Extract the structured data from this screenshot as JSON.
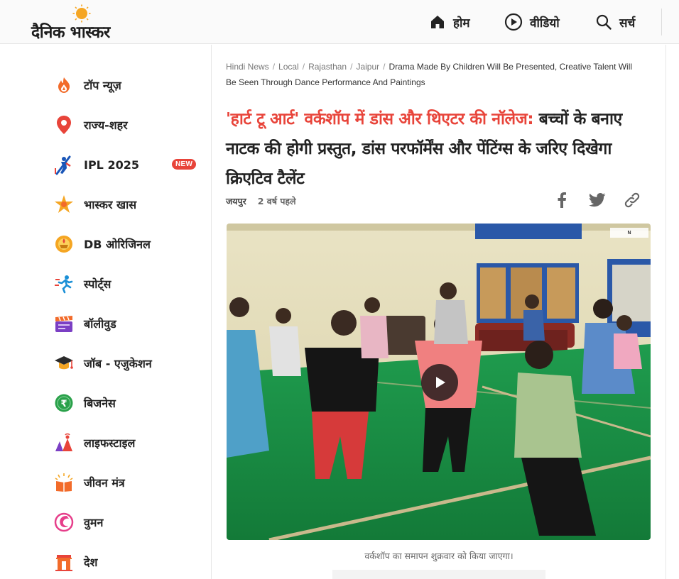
{
  "header": {
    "logo_text": "दैनिक भास्कर",
    "nav": [
      {
        "label": "होम",
        "icon": "home-icon"
      },
      {
        "label": "वीडियो",
        "icon": "play-circle-icon"
      },
      {
        "label": "सर्च",
        "icon": "search-icon"
      }
    ]
  },
  "sidebar": {
    "items": [
      {
        "label": "टॉप न्यूज़",
        "icon": "fire-icon"
      },
      {
        "label": "राज्य-शहर",
        "icon": "location-pin-icon"
      },
      {
        "label": "IPL 2025",
        "icon": "cricket-batsman-icon",
        "badge": "NEW"
      },
      {
        "label": "भास्कर खास",
        "icon": "star-burst-icon"
      },
      {
        "label": "DB ओरिजिनल",
        "icon": "diya-icon"
      },
      {
        "label": "स्पोर्ट्स",
        "icon": "runner-icon"
      },
      {
        "label": "बॉलीवुड",
        "icon": "clapperboard-icon"
      },
      {
        "label": "जॉब - एजुकेशन",
        "icon": "graduation-cap-icon"
      },
      {
        "label": "बिजनेस",
        "icon": "rupee-coin-icon"
      },
      {
        "label": "लाइफस्टाइल",
        "icon": "lifestyle-icon"
      },
      {
        "label": "जीवन मंत्र",
        "icon": "book-icon"
      },
      {
        "label": "वुमन",
        "icon": "woman-icon"
      },
      {
        "label": "देश",
        "icon": "india-gate-icon"
      }
    ]
  },
  "breadcrumb": {
    "items": [
      "Hindi News",
      "Local",
      "Rajasthan",
      "Jaipur"
    ],
    "current": "Drama Made By Children Will Be Presented, Creative Talent Will Be Seen Through Dance Performance And Paintings"
  },
  "article": {
    "headline_highlight": "'हार्ट टू आर्ट' वर्कशॉप में डांस और थिएटर की नॉलेज:",
    "headline_rest": " बच्चों के बनाए नाटक की होगी प्रस्तुत, डांस परफॉर्मेंस और पेंटिंग्स के जरिए दिखेगा क्रिएटिव टैलेंट",
    "location": "जयपुर",
    "time": "2 वर्ष पहले",
    "caption": "वर्कशॉप का समापन शुक्रवार को किया जाएगा।"
  },
  "colors": {
    "accent_red": "#e8443a",
    "text_dark": "#222222"
  }
}
